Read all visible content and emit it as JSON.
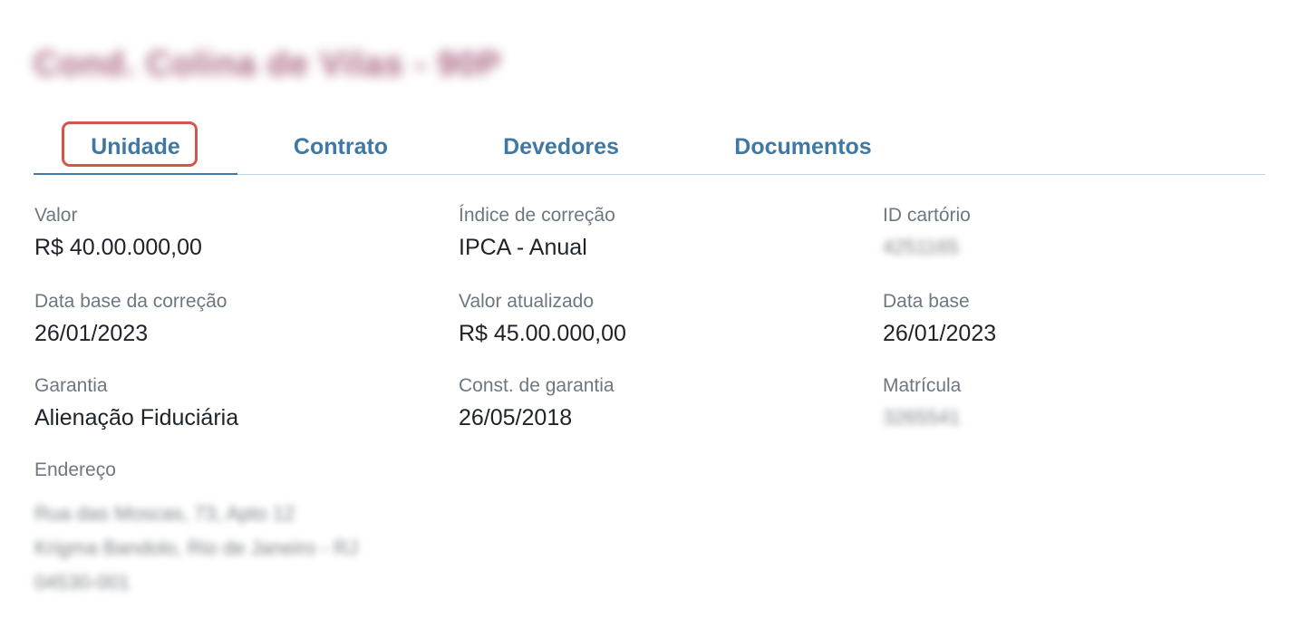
{
  "page_title": "Cond. Colina de Vilas - 90P",
  "tabs": [
    {
      "label": "Unidade",
      "active": true
    },
    {
      "label": "Contrato",
      "active": false
    },
    {
      "label": "Devedores",
      "active": false
    },
    {
      "label": "Documentos",
      "active": false
    }
  ],
  "fields": {
    "valor": {
      "label": "Valor",
      "value": "R$ 40.00.000,00"
    },
    "indice": {
      "label": "Índice de correção",
      "value": "IPCA - Anual"
    },
    "id_cartorio": {
      "label": "ID cartório",
      "value": "4251165"
    },
    "data_base_correcao": {
      "label": "Data base da correção",
      "value": "26/01/2023"
    },
    "valor_atualizado": {
      "label": "Valor atualizado",
      "value": "R$ 45.00.000,00"
    },
    "data_base": {
      "label": "Data base",
      "value": "26/01/2023"
    },
    "garantia": {
      "label": "Garantia",
      "value": "Alienação Fiduciária"
    },
    "const_garantia": {
      "label": "Const. de garantia",
      "value": "26/05/2018"
    },
    "matricula": {
      "label": "Matrícula",
      "value": "3265541"
    },
    "endereco": {
      "label": "Endereço",
      "lines": [
        "Rua das Moscas, 73, Apto 12",
        "Krigma Bandolo, Rio de Janeiro - RJ",
        "04530-001"
      ]
    }
  },
  "colors": {
    "title": "#8a2c57",
    "tab_text": "#3f78a4",
    "tab_border": "#bcd4e6",
    "highlight": "#d4564b",
    "label": "#6e7780",
    "value": "#1d2329"
  }
}
